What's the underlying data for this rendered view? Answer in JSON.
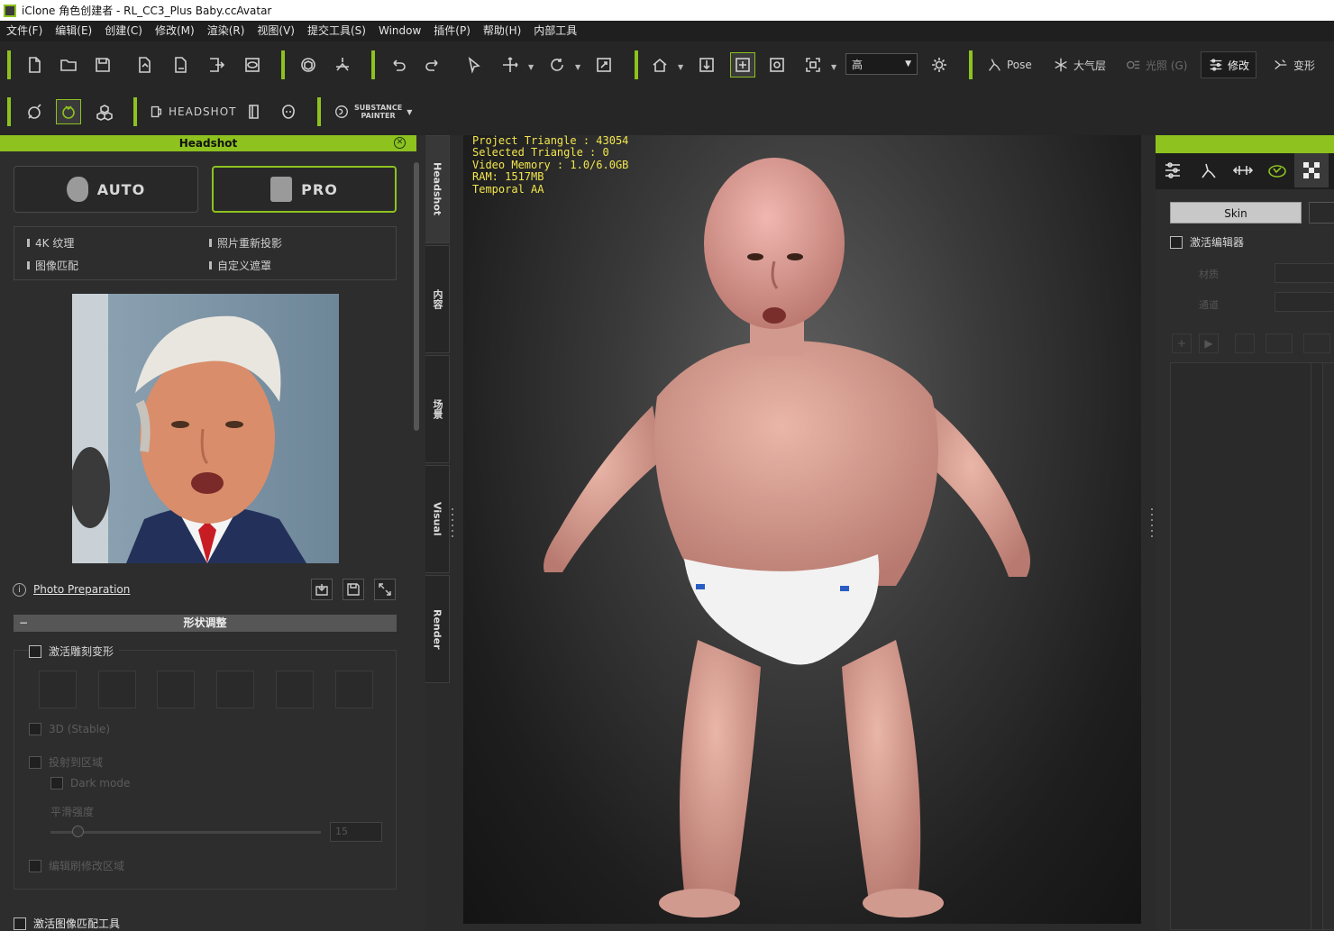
{
  "window": {
    "title": "iClone 角色创建者 - RL_CC3_Plus Baby.ccAvatar"
  },
  "menu": [
    "文件(F)",
    "编辑(E)",
    "创建(C)",
    "修改(M)",
    "渲染(R)",
    "视图(V)",
    "提交工具(S)",
    "Window",
    "插件(P)",
    "帮助(H)",
    "内部工具"
  ],
  "toolbar1": {
    "quality_value": "高",
    "pose_label": "Pose",
    "atmosphere_label": "大气层",
    "render_label": "光照 (G)",
    "modify_label": "修改",
    "morph_label": "变形"
  },
  "toolbar2": {
    "headshot_label": "HEADSHOT",
    "substance_line1": "SUBSTANCE",
    "substance_line2": "PAINTER"
  },
  "left_panel": {
    "header": "Headshot",
    "auto_label": "AUTO",
    "pro_label": "PRO",
    "features": [
      "4K 纹理",
      "照片重新投影",
      "图像匹配",
      "自定义遮罩"
    ],
    "photo_prep_label": "Photo Preparation",
    "section_title": "形状调整",
    "sculpt_checkbox": "激活雕刻变形",
    "disabled_opts": [
      "3D (Stable)",
      "投射到区域",
      "Dark mode",
      "平滑强度",
      "编辑刷修改区域"
    ],
    "spin_value": "15",
    "bottom_checkbox": "激活图像匹配工具"
  },
  "vertical_tabs": [
    "Headshot",
    "内容",
    "场景",
    "Visual",
    "Render"
  ],
  "viewport": {
    "stats": [
      "Project Triangle : 43054",
      "Selected Triangle : 0",
      "Video Memory : 1.0/6.0GB",
      "RAM: 1517MB",
      "Temporal AA"
    ]
  },
  "right_panel": {
    "skin_label": "Skin",
    "activate_editor_label": "激活编辑器",
    "row1_label": "材质",
    "row2_label": "通道"
  },
  "colors": {
    "accent": "#8dc21f",
    "stats_text": "#f2e64d"
  }
}
